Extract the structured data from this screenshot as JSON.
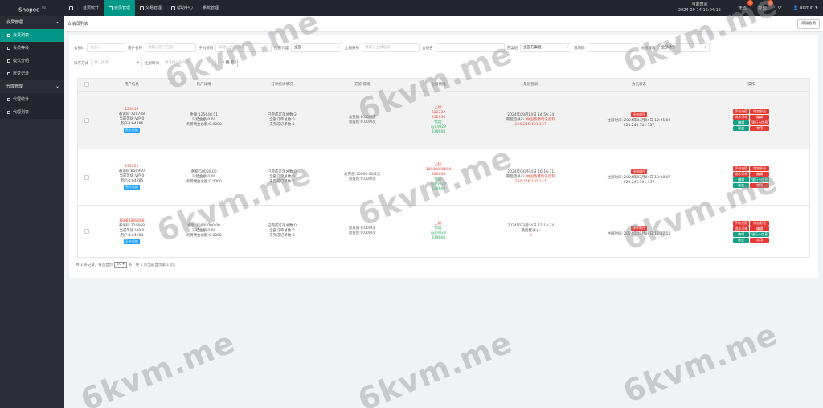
{
  "brand": {
    "name": "Shopee",
    "version": "V6"
  },
  "topnav": [
    {
      "label": "首页统计"
    },
    {
      "label": "会员管理"
    },
    {
      "label": "交易管理"
    },
    {
      "label": "帮助中心"
    },
    {
      "label": "系统管理"
    }
  ],
  "topright": {
    "time_label": "当前时间",
    "time_value": "2024-09-14 15:04:15",
    "recharge": "充值",
    "recharge_badge": "1",
    "withdraw": "提现",
    "withdraw_badge": "0",
    "user": "admin"
  },
  "sidebar": {
    "group1": "会员管理",
    "items1": [
      "会员列表",
      "会员等级",
      "模式分组",
      "账变记录"
    ],
    "group2": "代理管理",
    "items2": [
      "代理统计",
      "代理列表"
    ]
  },
  "tabbar": {
    "home": "会员列表",
    "add_button": "添加会员"
  },
  "filters": {
    "row1": [
      {
        "label": "会员id",
        "value": "会员id",
        "kind": "placeholder"
      },
      {
        "label": "用户名称",
        "value": "请输入用户名称",
        "kind": "placeholder"
      },
      {
        "label": "手机号码",
        "value": "请输入手机号码",
        "kind": "placeholder"
      },
      {
        "label": "内部代理",
        "value": "全部",
        "kind": "select"
      },
      {
        "label": "上级账号",
        "value": "请输入上级账号",
        "kind": "placeholder"
      },
      {
        "label": "会员名",
        "value": "",
        "kind": "placeholder"
      },
      {
        "label": "方案组",
        "value": "全部方案组",
        "kind": "select"
      },
      {
        "label": "邀请码",
        "value": "",
        "kind": "placeholder"
      },
      {
        "label": "会员等级",
        "value": "全部级别",
        "kind": "select"
      }
    ],
    "row2": [
      {
        "label": "排序方式",
        "value": "默认排序",
        "kind": "select"
      },
      {
        "label": "注册时间",
        "value": "请选择注册时间",
        "kind": "placeholder"
      }
    ],
    "search_button": "搜 索"
  },
  "table": {
    "headers": [
      "",
      "用户信息",
      "账户详情",
      "订单统计情况",
      "充值/提现",
      "上级代理",
      "最近登录",
      "会员状态",
      "操作"
    ],
    "rows": [
      {
        "user": {
          "name": "123456",
          "invite": "邀请码:728748",
          "level": "当前等级:VIP:0",
          "uid": "用户id:64286",
          "tag": "无方案组"
        },
        "account": [
          "余额:125648.01",
          "冻结金额:0.00",
          "点赞佣金总额:0.0000"
        ],
        "orders": [
          "已完成订单总数:2",
          "全部订单总数:0",
          "未完成订单数:0"
        ],
        "money": [
          "总充值:0.00/0次",
          "总提现:0.00/0次"
        ],
        "agent": {
          "label": "上级:",
          "name": "222222",
          "id": "850950",
          "agent_label": "代理:",
          "agent_name": "ryan029",
          "agent_id": "339668"
        },
        "login": {
          "time": "2024年09月14日 14:56:34",
          "ip_label": "最后登录ip:",
          "ip_place": "中国香港电讯盈科",
          "ip": "(220.246.101.137)"
        },
        "status": {
          "tag": "接单顺序",
          "reg_label": "注册时间:",
          "reg": "2024年03月04日 12:25:02",
          "ip": "220.246.101.137"
        },
        "ops": [
          "手动充值",
          "增加彩金",
          "流水订单",
          "编辑",
          "编辑",
          "银行卡信息",
          "账变",
          "禁用"
        ]
      },
      {
        "user": {
          "name": "222222",
          "invite": "邀请码:850950",
          "level": "当前等级:VIP:0",
          "uid": "用户id:64285",
          "tag": "无方案组"
        },
        "account": [
          "余额:50000.00",
          "冻结金额:0.00",
          "点赞佣金总额:0.0000"
        ],
        "orders": [
          "已完成订单总数:0",
          "全部订单总数:0",
          "未完成订单数:0"
        ],
        "money": [
          "总充值:50000.00/1次",
          "总提现:0.00/0次"
        ],
        "agent": {
          "label": "上级:",
          "name": "18888888888",
          "id": "220668",
          "agent_label": "代理:",
          "agent_name": "ryan029",
          "agent_id": "339668"
        },
        "login": {
          "time": "2024年04月04日 16:16:31",
          "ip_label": "最后登录ip:",
          "ip_place": "中国香港电讯盈科",
          "ip": "(220.246.101.137)"
        },
        "status": {
          "tag": "接单顺序",
          "reg_label": "注册时间:",
          "reg": "2024年03月04日 12:08:07",
          "ip": "220.246.101.137"
        },
        "ops": [
          "手动充值",
          "增加彩金",
          "流水订单",
          "编辑",
          "编辑",
          "银行卡信息",
          "账变",
          "禁用"
        ]
      },
      {
        "user": {
          "name": "18888888888",
          "invite": "邀请码:220668",
          "level": "当前等级:VIP:0",
          "uid": "用户id:64284",
          "tag": "无方案组"
        },
        "account": [
          "余额:10000000.00",
          "冻结金额:0.00",
          "点赞佣金总额:0.0000"
        ],
        "orders": [
          "已完成订单总数:0",
          "全部订单总数:0",
          "未完成订单数:0"
        ],
        "money": [
          "总充值:0.00/0次",
          "总提现:0.00/0次"
        ],
        "agent": {
          "label": "上级:",
          "name": "",
          "id": "",
          "agent_label": "代理:",
          "agent_name": "ryan029",
          "agent_id": "339668"
        },
        "login": {
          "time": "2024年03月04日 12:14:34",
          "ip_label": "最后登录ip:",
          "ip_place": "",
          "ip": "0"
        },
        "status": {
          "tag": "接单顺序",
          "reg_label": "注册时间:",
          "reg": "2024年03月04日 12:07:50",
          "ip": ""
        },
        "ops": [
          "手动充值",
          "增加彩金",
          "流水订单",
          "编辑",
          "编辑",
          "银行卡信息",
          "账变",
          "禁用"
        ]
      }
    ]
  },
  "pager": {
    "prefix": "共 3 条记录，每页显示",
    "size": "20",
    "suffix": "条，共 1 页当前显示第 1 页。"
  },
  "watermark": "6kvm.me"
}
